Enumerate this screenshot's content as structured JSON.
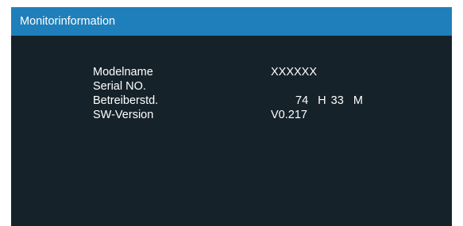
{
  "dialog": {
    "title": "Monitorinformation"
  },
  "info": {
    "model_label": "Modelname",
    "model_value": "XXXXXX",
    "serial_label": "Serial NO.",
    "serial_value": "",
    "runtime_label": "Betreiberstd.",
    "runtime_value": "74  H 33  M",
    "sw_label": "SW-Version",
    "sw_value": "V0.217"
  },
  "colors": {
    "title_bar": "#1f7fba",
    "panel_background": "#15222a",
    "text": "#ffffff"
  }
}
